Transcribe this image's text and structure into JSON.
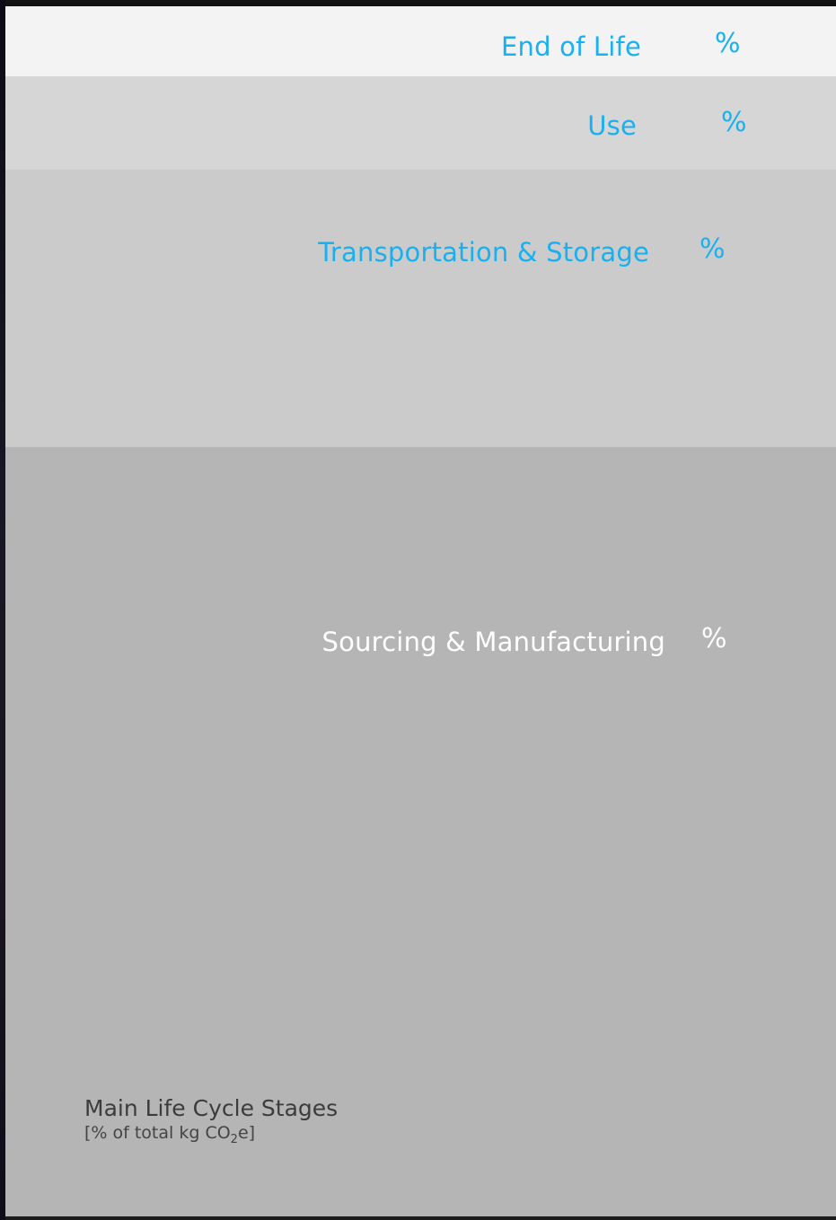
{
  "chart_data": {
    "type": "bar",
    "orientation": "stacked-vertical",
    "title": "Main Life Cycle Stages",
    "subtitle_parts": [
      "[% of total kg CO",
      "2",
      "e]"
    ],
    "label_color": "#1ab0f0",
    "segments": [
      {
        "label": "End of Life",
        "pct_text": "%",
        "share": 0.058,
        "color": "#f3f3f3",
        "text_color": "#1ab0f0"
      },
      {
        "label": "Use",
        "pct_text": "%",
        "share": 0.077,
        "color": "#d6d6d6",
        "text_color": "#1ab0f0"
      },
      {
        "label": "Transportation & Storage",
        "pct_text": "%",
        "share": 0.229,
        "color": "#cbcbcb",
        "text_color": "#1ab0f0"
      },
      {
        "label": "Sourcing & Manufacturing",
        "pct_text": "%",
        "share": 0.636,
        "color": "#b5b5b5",
        "text_color": "#ffffff"
      }
    ]
  }
}
